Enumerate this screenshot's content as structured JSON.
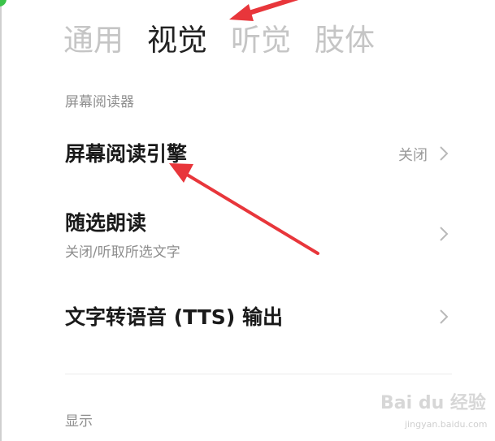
{
  "tabs": [
    {
      "label": "通用"
    },
    {
      "label": "视觉",
      "active": true
    },
    {
      "label": "听觉"
    },
    {
      "label": "肢体"
    }
  ],
  "sections": {
    "screen_reader": {
      "header": "屏幕阅读器",
      "items": [
        {
          "title": "屏幕阅读引擎",
          "value": "关闭"
        },
        {
          "title": "随选朗读",
          "subtitle": "关闭/听取所选文字"
        },
        {
          "title": "文字转语音 (TTS) 输出"
        }
      ]
    },
    "display": {
      "header": "显示"
    }
  },
  "watermark": {
    "brand": "Bai du 经验",
    "sub": "jingyan.baidu.com"
  },
  "colors": {
    "annotation_arrow": "#e8363b",
    "active_tab": "#222222",
    "inactive_tab": "#c5c5c5",
    "secondary_text": "#8e8e8e",
    "corner_dot": "#3cc34a"
  }
}
